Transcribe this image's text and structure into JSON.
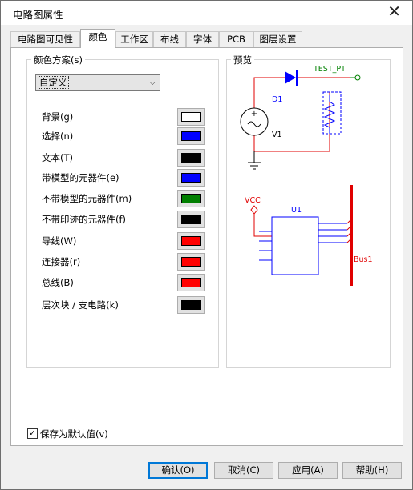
{
  "window": {
    "title": "电路图属性",
    "close_glyph": "✕"
  },
  "tabs": [
    {
      "label": "电路图可见性"
    },
    {
      "label": "颜色"
    },
    {
      "label": "工作区"
    },
    {
      "label": "布线"
    },
    {
      "label": "字体"
    },
    {
      "label": "PCB"
    },
    {
      "label": "图层设置"
    }
  ],
  "color_scheme": {
    "group_label": "颜色方案(s)",
    "selected": "自定义",
    "chevron": "⌵",
    "items": [
      {
        "label": "背景(g)",
        "color": "#ffffff"
      },
      {
        "label": "选择(n)",
        "color": "#0000ff"
      },
      {
        "label": "文本(T)",
        "color": "#000000"
      },
      {
        "label": "带模型的元器件(e)",
        "color": "#0000ff"
      },
      {
        "label": "不带模型的元器件(m)",
        "color": "#007f00"
      },
      {
        "label": "不带印迹的元器件(f)",
        "color": "#000000"
      },
      {
        "label": "导线(W)",
        "color": "#ff0000"
      },
      {
        "label": "连接器(r)",
        "color": "#ff0000"
      },
      {
        "label": "总线(B)",
        "color": "#ff0000"
      },
      {
        "label": "层次块 / 支电路(k)",
        "color": "#000000"
      }
    ]
  },
  "preview": {
    "group_label": "预览",
    "d1": "D1",
    "test_pt": "TEST_PT",
    "v1": "V1",
    "vcc": "VCC",
    "u1": "U1",
    "bus1": "Bus1"
  },
  "save_default": {
    "label": "保存为默认值(v)",
    "checked": "✓"
  },
  "buttons": {
    "ok": "确认(O)",
    "cancel": "取消(C)",
    "apply": "应用(A)",
    "help": "帮助(H)"
  }
}
